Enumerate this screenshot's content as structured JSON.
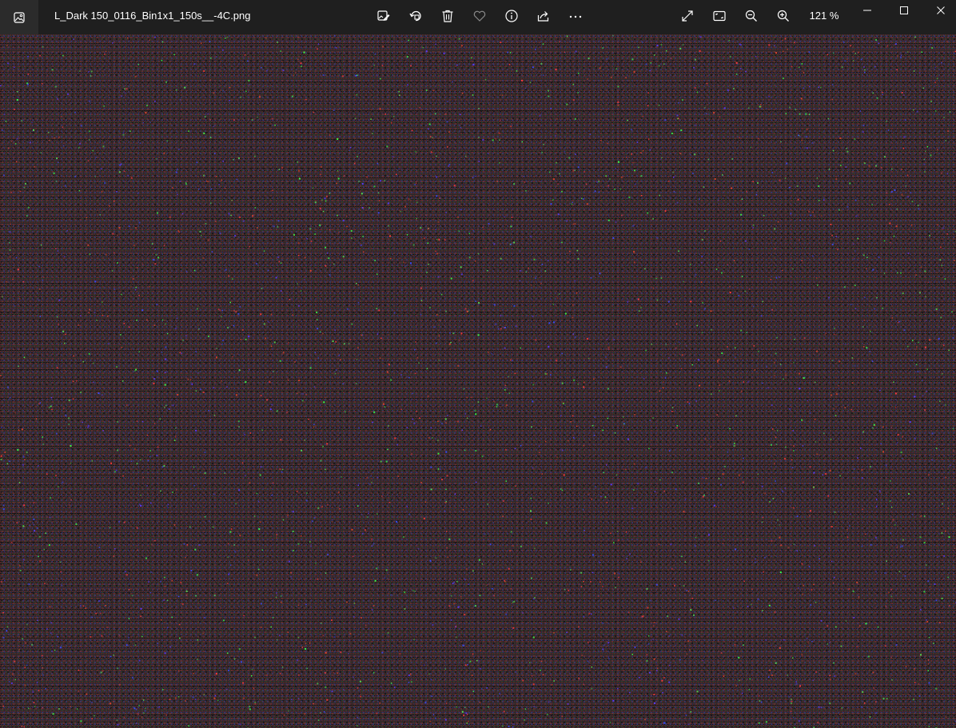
{
  "window": {
    "filename": "L_Dark 150_0116_Bin1x1_150s__-4C.png",
    "zoom_label": "121 %"
  },
  "toolbar": {
    "icons": [
      "edit-image-icon",
      "rotate-icon",
      "delete-icon",
      "favorite-icon",
      "info-icon",
      "share-icon",
      "more-icon"
    ]
  },
  "view_controls": {
    "icons": [
      "fullscreen-icon",
      "fit-to-window-icon",
      "zoom-out-icon",
      "zoom-in-icon"
    ]
  },
  "window_controls": {
    "icons": [
      "minimize-icon",
      "maximize-icon",
      "close-icon"
    ]
  },
  "colors": {
    "titlebar": "#1f1f1f",
    "app_button": "#2b2b2b",
    "image_base": "#2a2a2c",
    "icon": "#ffffff"
  }
}
